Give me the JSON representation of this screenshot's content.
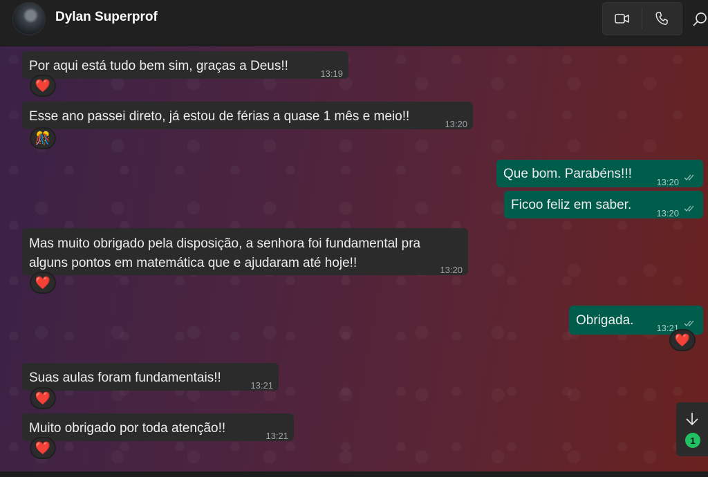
{
  "header": {
    "contact_name": "Dylan Superprof",
    "video_call_icon": "video-camera-icon",
    "voice_call_icon": "phone-icon",
    "search_icon": "search-icon"
  },
  "colors": {
    "incoming_bubble": "#2b2b2b",
    "outgoing_bubble": "#005c4b",
    "header_bg": "#202020",
    "unread_badge": "#21c063"
  },
  "messages": [
    {
      "direction": "incoming",
      "text": "Por aqui está tudo bem sim, graças a Deus!!",
      "time": "13:19",
      "reaction": "❤️"
    },
    {
      "direction": "incoming",
      "text": "Esse ano passei direto, já estou de férias a quase 1 mês e meio!!",
      "time": "13:20",
      "reaction": "🎊"
    },
    {
      "direction": "outgoing",
      "text": "Que bom. Parabéns!!!",
      "time": "13:20",
      "status": "read"
    },
    {
      "direction": "outgoing",
      "text": "Ficoo feliz em saber.",
      "time": "13:20",
      "status": "read"
    },
    {
      "direction": "incoming",
      "text_line1": "Mas muito obrigado pela disposição, a senhora foi  fundamental pra",
      "text_line2": "alguns pontos em matemática que e ajudaram até hoje!!",
      "time": "13:20",
      "reaction": "❤️"
    },
    {
      "direction": "outgoing",
      "text": "Obrigada.",
      "time": "13:21",
      "status": "read",
      "reaction": "❤️"
    },
    {
      "direction": "incoming",
      "text": "Suas aulas foram fundamentais!!",
      "time": "13:21",
      "reaction": "❤️"
    },
    {
      "direction": "incoming",
      "text": "Muito obrigado por toda atenção!!",
      "time": "13:21",
      "reaction": "❤️"
    }
  ],
  "scroll_to_bottom": {
    "icon": "arrow-down-icon",
    "unread_count": "1"
  }
}
